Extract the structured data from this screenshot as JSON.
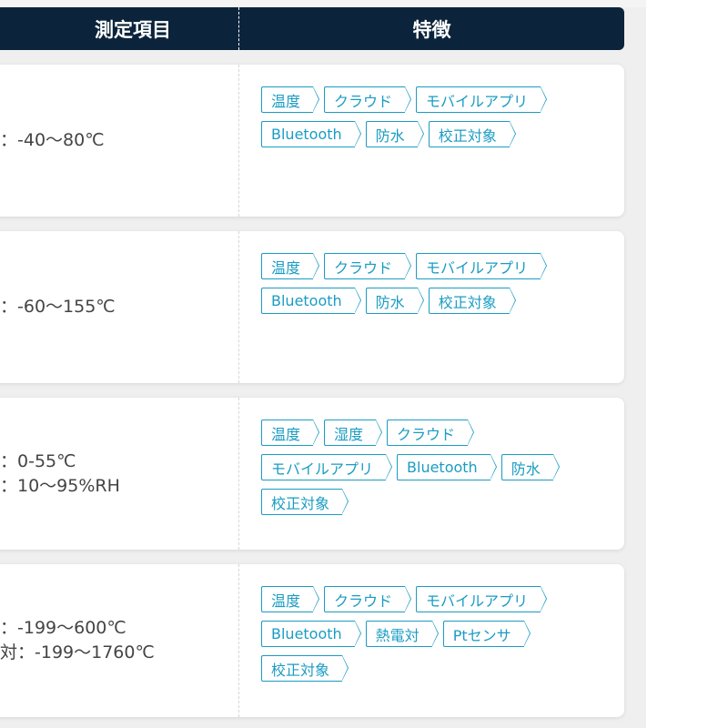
{
  "header": {
    "col_measure": "測定項目",
    "col_features": "特徴"
  },
  "colors": {
    "header_bg": "#0b243b",
    "tag_accent": "#1a9cc3",
    "text": "#444444"
  },
  "rows": [
    {
      "measurement_lines": [
        "：-40〜80℃"
      ],
      "tags": [
        "温度",
        "クラウド",
        "モバイルアプリ",
        "Bluetooth",
        "防水",
        "校正対象"
      ]
    },
    {
      "measurement_lines": [
        "：-60〜155℃"
      ],
      "tags": [
        "温度",
        "クラウド",
        "モバイルアプリ",
        "Bluetooth",
        "防水",
        "校正対象"
      ]
    },
    {
      "measurement_lines": [
        "：0-55℃",
        "：10〜95%RH"
      ],
      "tags": [
        "温度",
        "湿度",
        "クラウド",
        "モバイルアプリ",
        "Bluetooth",
        "防水",
        "校正対象"
      ]
    },
    {
      "measurement_lines": [
        "：-199〜600℃",
        "対：-199〜1760℃"
      ],
      "tags": [
        "温度",
        "クラウド",
        "モバイルアプリ",
        "Bluetooth",
        "熱電対",
        "Ptセンサ",
        "校正対象"
      ]
    }
  ]
}
